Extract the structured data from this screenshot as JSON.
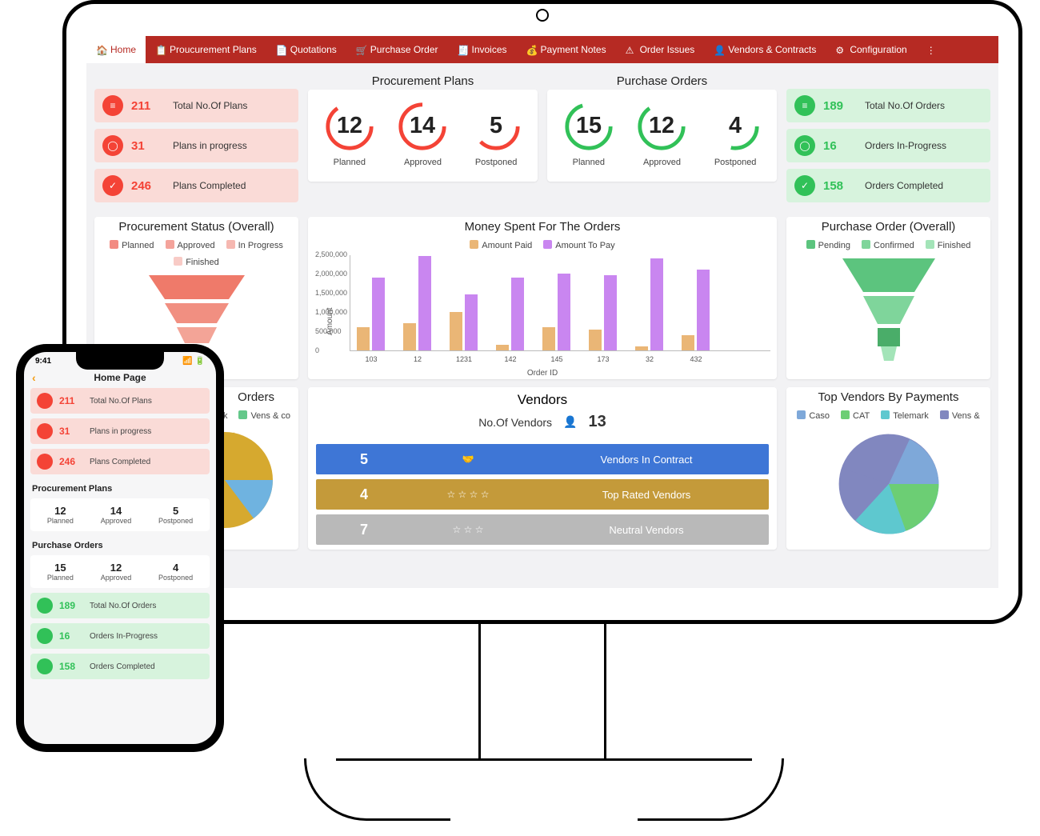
{
  "nav": {
    "items": [
      {
        "label": "Home",
        "active": true
      },
      {
        "label": "Proucurement Plans"
      },
      {
        "label": "Quotations"
      },
      {
        "label": "Purchase Order"
      },
      {
        "label": "Invoices"
      },
      {
        "label": "Payment Notes"
      },
      {
        "label": "Order Issues"
      },
      {
        "label": "Vendors & Contracts"
      },
      {
        "label": "Configuration"
      }
    ]
  },
  "headers": {
    "proc_plans": "Procurement Plans",
    "purch_orders": "Purchase Orders",
    "proc_status": "Procurement Status (Overall)",
    "money_spent": "Money Spent For The Orders",
    "po_overall": "Purchase Order (Overall)",
    "orders_trunc": "Orders",
    "vendors": "Vendors",
    "top_vendors": "Top Vendors By Payments"
  },
  "plan_stats": [
    {
      "value": "211",
      "label": "Total No.Of Plans"
    },
    {
      "value": "31",
      "label": "Plans in progress"
    },
    {
      "value": "246",
      "label": "Plans Completed"
    }
  ],
  "order_stats": [
    {
      "value": "189",
      "label": "Total No.Of Orders"
    },
    {
      "value": "16",
      "label": "Orders In-Progress"
    },
    {
      "value": "158",
      "label": "Orders Completed"
    }
  ],
  "circles": {
    "plans": [
      {
        "v": "12",
        "l": "Planned"
      },
      {
        "v": "14",
        "l": "Approved"
      },
      {
        "v": "5",
        "l": "Postponed"
      }
    ],
    "orders": [
      {
        "v": "15",
        "l": "Planned"
      },
      {
        "v": "12",
        "l": "Approved"
      },
      {
        "v": "4",
        "l": "Postponed"
      }
    ]
  },
  "proc_legend": [
    "Planned",
    "Approved",
    "In Progress",
    "Finished"
  ],
  "po_legend": [
    "Pending",
    "Confirmed",
    "Finished"
  ],
  "money_legend": {
    "a": "Amount Paid",
    "b": "Amount To Pay",
    "y": "Amount",
    "x": "Order ID"
  },
  "vendors": {
    "count_label": "No.Of Vendors",
    "count": "13",
    "rows": [
      {
        "n": "5",
        "t": "Vendors In Contract",
        "c": "#3e76d6"
      },
      {
        "n": "4",
        "t": "Top Rated Vendors",
        "c": "#c49a3a"
      },
      {
        "n": "7",
        "t": "Neutral Vendors",
        "c": "#b9b9b9"
      }
    ]
  },
  "top_vendors_legend": [
    "Caso",
    "CAT",
    "Telemark",
    "Vens &"
  ],
  "orders_peek_legend": [
    "rk",
    "Vens & co"
  ],
  "chart_data": {
    "type": "bar",
    "title": "Money Spent For The Orders",
    "xlabel": "Order ID",
    "ylabel": "Amount",
    "ylim": [
      0,
      2500000
    ],
    "yticks": [
      0,
      500000,
      1000000,
      1500000,
      2000000,
      2500000
    ],
    "categories": [
      "103",
      "12",
      "1231",
      "142",
      "145",
      "173",
      "32",
      "432"
    ],
    "series": [
      {
        "name": "Amount Paid",
        "color": "#eab676",
        "values": [
          600000,
          700000,
          1000000,
          150000,
          600000,
          550000,
          100000,
          400000
        ]
      },
      {
        "name": "Amount To Pay",
        "color": "#c986f0",
        "values": [
          1900000,
          2450000,
          1450000,
          1900000,
          2000000,
          1950000,
          2400000,
          2100000
        ]
      }
    ]
  },
  "phone": {
    "time": "9:41",
    "title": "Home Page",
    "sections": {
      "proc": "Procurement Plans",
      "po": "Purchase Orders"
    }
  }
}
